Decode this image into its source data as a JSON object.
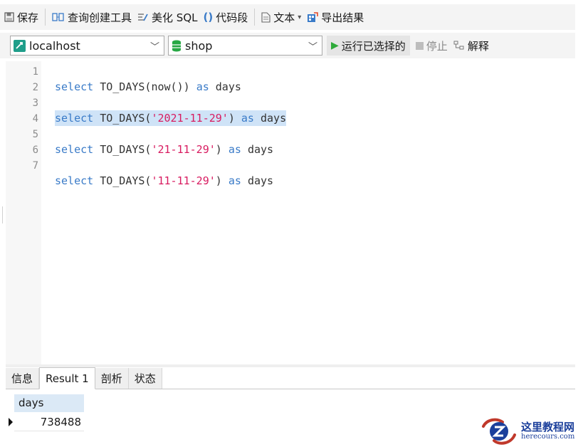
{
  "toolbar": {
    "save": "保存",
    "query_builder": "查询创建工具",
    "beautify": "美化 SQL",
    "snippet": "代码段",
    "text": "文本",
    "export": "导出结果"
  },
  "connection": {
    "host": "localhost",
    "database": "shop"
  },
  "actions": {
    "run_selected": "运行已选择的",
    "stop": "停止",
    "explain": "解释"
  },
  "editor": {
    "line_numbers": [
      "1",
      "2",
      "3",
      "4",
      "5",
      "6",
      "7"
    ],
    "lines": [
      {
        "kw1": "select",
        "fn": "TO_DAYS(now())",
        "str": "",
        "tail": "",
        "kw2": "as",
        "alias": "days"
      },
      {
        "kw1": "select",
        "fn": "TO_DAYS(",
        "str": "'2021-11-29'",
        "tail": ")",
        "kw2": "as",
        "alias": "days"
      },
      {
        "kw1": "select",
        "fn": "TO_DAYS(",
        "str": "'21-11-29'",
        "tail": ")",
        "kw2": "as",
        "alias": "days"
      },
      {
        "kw1": "select",
        "fn": "TO_DAYS(",
        "str": "'11-11-29'",
        "tail": ")",
        "kw2": "as",
        "alias": "days"
      }
    ]
  },
  "result": {
    "tabs": [
      "信息",
      "Result 1",
      "剖析",
      "状态"
    ],
    "active_tab": "Result 1",
    "columns": [
      "days"
    ],
    "rows": [
      [
        "738488"
      ]
    ]
  },
  "watermark": {
    "main": "这里教程网",
    "sub": "herecours.com"
  },
  "colors": {
    "keyword": "#3a7bc8",
    "string": "#d81b60",
    "selection": "#cfe3f7",
    "run_icon": "#2eaa3a"
  }
}
